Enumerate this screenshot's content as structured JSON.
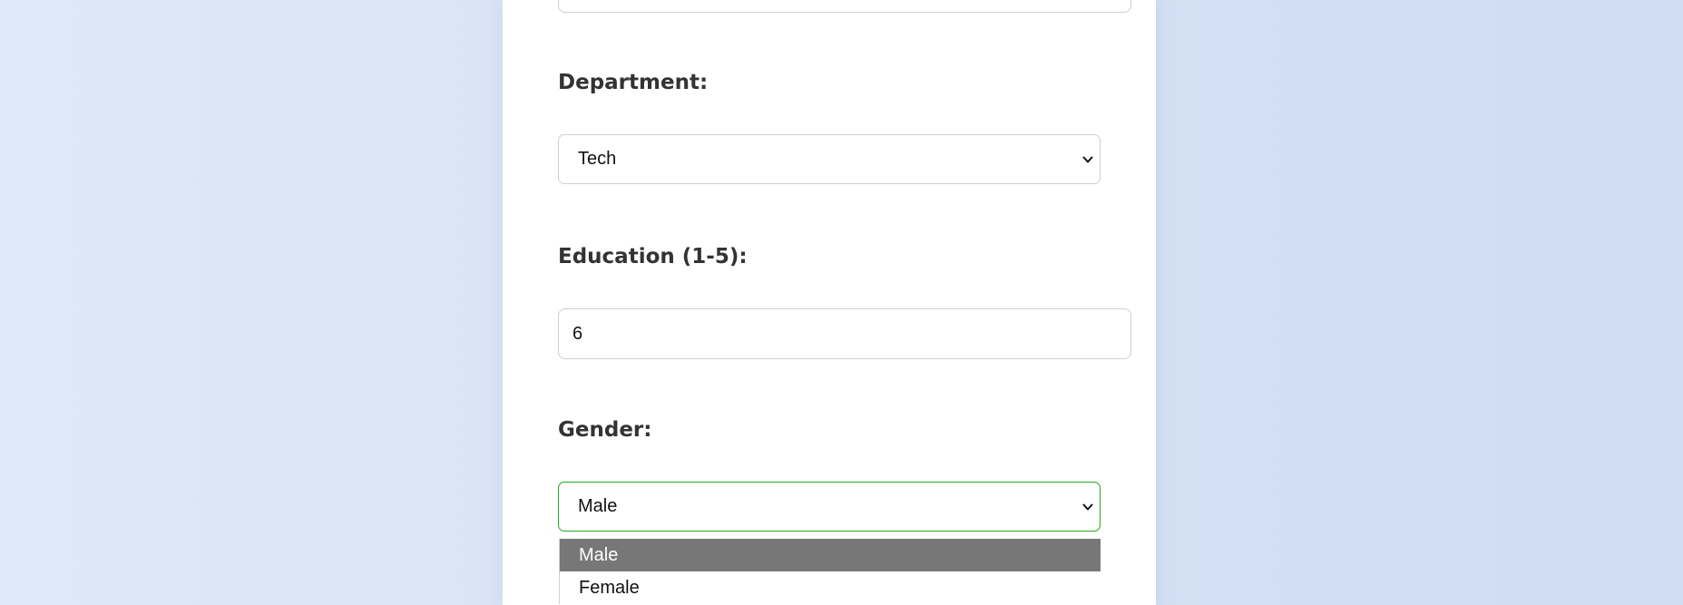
{
  "form": {
    "department": {
      "label": "Department:",
      "value": "Tech"
    },
    "education": {
      "label": "Education (1-5):",
      "value": "6"
    },
    "gender": {
      "label": "Gender:",
      "value": "Male",
      "options": [
        "Male",
        "Female"
      ],
      "highlighted_option": "Male"
    }
  },
  "colors": {
    "focus_border": "#22aa22",
    "highlight_bg": "#777777",
    "label_text": "#333333"
  }
}
